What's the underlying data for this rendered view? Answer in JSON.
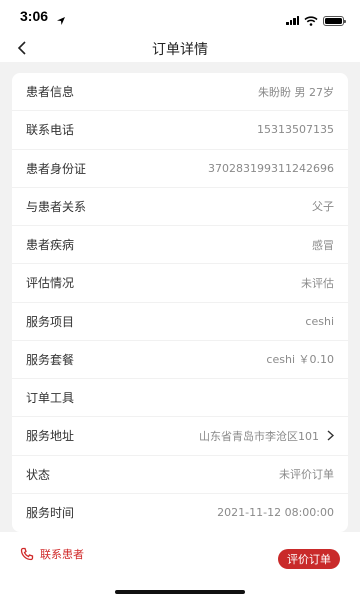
{
  "status_bar": {
    "time": "3:06"
  },
  "nav": {
    "title": "订单详情"
  },
  "rows": [
    {
      "label": "患者信息",
      "value": "朱盼盼 男 27岁"
    },
    {
      "label": "联系电话",
      "value": "15313507135"
    },
    {
      "label": "患者身份证",
      "value": "370283199311242696"
    },
    {
      "label": "与患者关系",
      "value": "父子"
    },
    {
      "label": "患者疾病",
      "value": "感冒"
    },
    {
      "label": "评估情况",
      "value": "未评估"
    },
    {
      "label": "服务项目",
      "value": "ceshi"
    },
    {
      "label": "服务套餐",
      "value": "ceshi ￥0.10"
    },
    {
      "label": "订单工具",
      "value": ""
    },
    {
      "label": "服务地址",
      "value": "山东省青岛市李沧区101"
    },
    {
      "label": "状态",
      "value": "未评价订单"
    },
    {
      "label": "服务时间",
      "value": "2021-11-12 08:00:00"
    }
  ],
  "bottom": {
    "contact_label": "联系患者",
    "rate_button": "评价订单"
  },
  "colors": {
    "accent": "#c92a2a",
    "background": "#f2f2f2"
  }
}
